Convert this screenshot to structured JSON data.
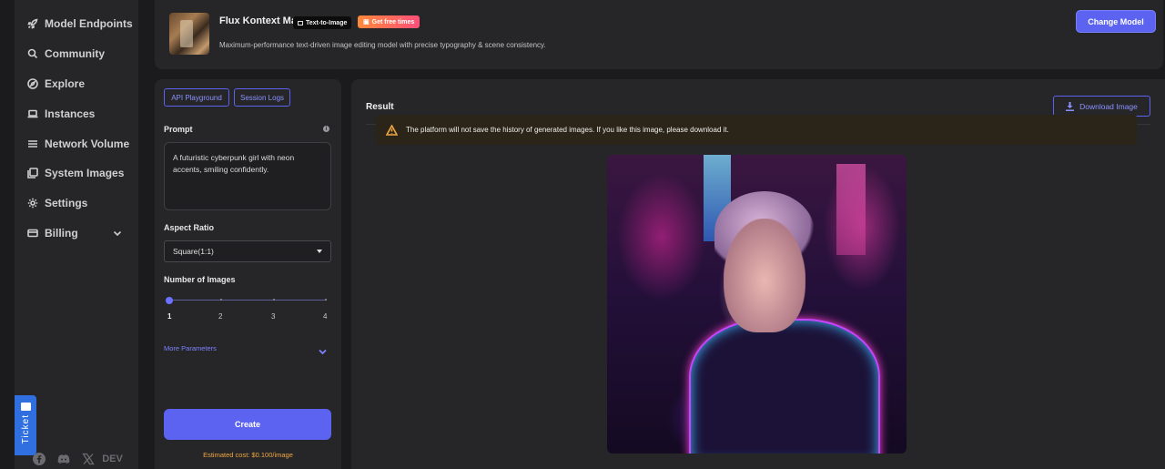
{
  "sidebar": {
    "items": [
      {
        "label": "Model Endpoints",
        "icon": "rocket-icon"
      },
      {
        "label": "Community",
        "icon": "community-search-icon"
      },
      {
        "label": "Explore",
        "icon": "compass-icon"
      },
      {
        "label": "Instances",
        "icon": "laptop-icon"
      },
      {
        "label": "Network Volume",
        "icon": "list-icon"
      },
      {
        "label": "System Images",
        "icon": "images-icon"
      },
      {
        "label": "Settings",
        "icon": "gear-icon"
      },
      {
        "label": "Billing",
        "icon": "card-icon"
      }
    ],
    "socials": {
      "dev": "DEV"
    },
    "ticket": "Ticket"
  },
  "header": {
    "model_name": "Flux Kontext Max",
    "tag": "Text-to-Image",
    "promo": "Get free times",
    "description": "Maximum-performance text-driven image editing model with precise typography & scene consistency.",
    "change_model": "Change Model"
  },
  "panel": {
    "tabs": [
      "API Playground",
      "Session Logs"
    ],
    "prompt_label": "Prompt",
    "prompt_value": "A futuristic cyberpunk girl with neon accents, smiling confidently.",
    "aspect_label": "Aspect Ratio",
    "aspect_value": "Square(1:1)",
    "num_images_label": "Number of Images",
    "num_images_value": 1,
    "num_images_ticks": [
      "1",
      "2",
      "3",
      "4"
    ],
    "more_params": "More Parameters",
    "create": "Create",
    "cost": "Estimated cost: $0.100/image"
  },
  "result": {
    "title": "Result",
    "download": "Download Image",
    "warning": "The platform will not save the history of generated images. If you like this image, please download it."
  },
  "colors": {
    "accent": "#5b63f0",
    "warning": "#f0a742",
    "background": "#1b1b1d",
    "panel": "#262628"
  }
}
